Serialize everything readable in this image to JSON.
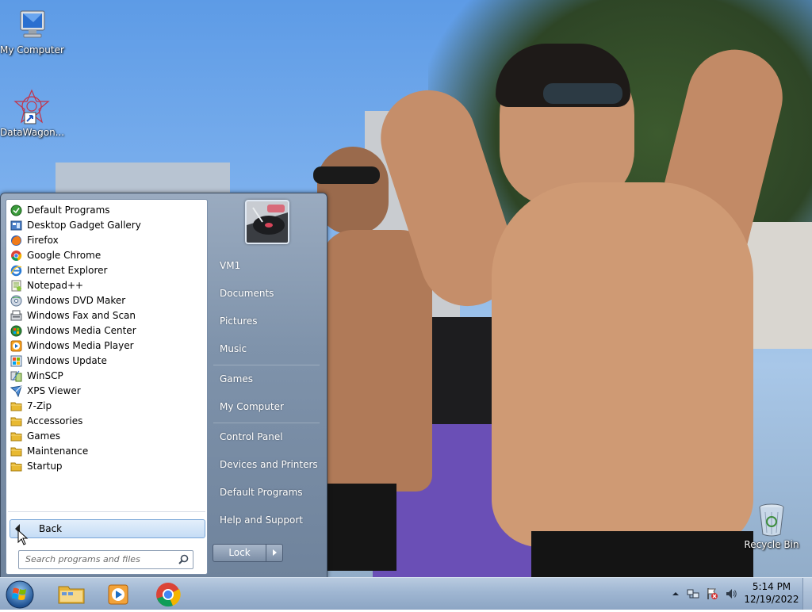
{
  "desktop": {
    "icons": [
      {
        "label": "My Computer",
        "icon": "computer-icon"
      },
      {
        "label": "DataWagon...",
        "icon": "datawagon-shortcut-icon"
      },
      {
        "label": "Recycle Bin",
        "icon": "recycle-bin-icon"
      }
    ]
  },
  "start_menu": {
    "programs": [
      {
        "label": "Default Programs",
        "icon": "default-programs-icon"
      },
      {
        "label": "Desktop Gadget Gallery",
        "icon": "gadget-gallery-icon"
      },
      {
        "label": "Firefox",
        "icon": "firefox-icon"
      },
      {
        "label": "Google Chrome",
        "icon": "chrome-icon"
      },
      {
        "label": "Internet Explorer",
        "icon": "internet-explorer-icon"
      },
      {
        "label": "Notepad++",
        "icon": "notepadpp-icon"
      },
      {
        "label": "Windows DVD Maker",
        "icon": "dvd-maker-icon"
      },
      {
        "label": "Windows Fax and Scan",
        "icon": "fax-scan-icon"
      },
      {
        "label": "Windows Media Center",
        "icon": "media-center-icon"
      },
      {
        "label": "Windows Media Player",
        "icon": "media-player-icon"
      },
      {
        "label": "Windows Update",
        "icon": "windows-update-icon"
      },
      {
        "label": "WinSCP",
        "icon": "winscp-icon"
      },
      {
        "label": "XPS Viewer",
        "icon": "xps-viewer-icon"
      },
      {
        "label": "7-Zip",
        "icon": "folder-icon"
      },
      {
        "label": "Accessories",
        "icon": "folder-icon"
      },
      {
        "label": "Games",
        "icon": "folder-icon"
      },
      {
        "label": "Maintenance",
        "icon": "folder-icon"
      },
      {
        "label": "Startup",
        "icon": "folder-icon"
      }
    ],
    "back_label": "Back",
    "search_placeholder": "Search programs and files",
    "right_items": [
      "VM1",
      "Documents",
      "Pictures",
      "Music",
      "Games",
      "My Computer",
      "Control Panel",
      "Devices and Printers",
      "Default Programs",
      "Help and Support"
    ],
    "lock_label": "Lock"
  },
  "taskbar": {
    "apps": [
      {
        "name": "explorer",
        "icon": "file-explorer-icon"
      },
      {
        "name": "media player",
        "icon": "media-player-icon"
      },
      {
        "name": "chrome",
        "icon": "chrome-icon"
      }
    ],
    "clock": {
      "time": "5:14 PM",
      "date": "12/19/2022"
    }
  }
}
